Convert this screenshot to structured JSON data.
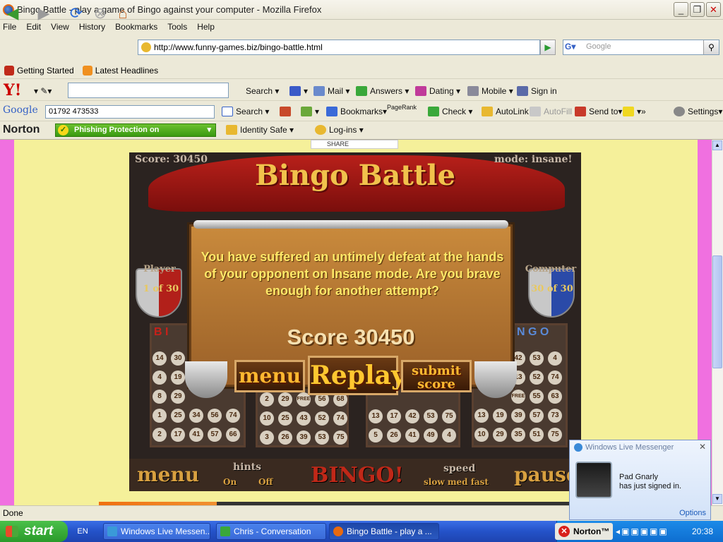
{
  "window": {
    "title": "Bingo Battle - play a game of Bingo against your computer - Mozilla Firefox",
    "minimize": "_",
    "maximize": "❐",
    "close": "✕"
  },
  "menu": [
    "File",
    "Edit",
    "View",
    "History",
    "Bookmarks",
    "Tools",
    "Help"
  ],
  "nav": {
    "url": "http://www.funny-games.biz/bingo-battle.html",
    "search_placeholder": "Google"
  },
  "bookmarks": [
    "Getting Started",
    "Latest Headlines"
  ],
  "yahoo": {
    "logo": "Y!",
    "search_label": "Search",
    "items": [
      "Mail",
      "Answers",
      "Dating",
      "Mobile",
      "Sign in"
    ]
  },
  "googlebar": {
    "logo": "Google",
    "query": "01792 473533",
    "items": [
      "Search",
      "Bookmarks",
      "PageRank",
      "Check",
      "AutoLink",
      "AutoFill",
      "Send to",
      "»",
      "Settings"
    ]
  },
  "norton": {
    "logo": "Norton",
    "phishing": "Phishing Protection on",
    "identity": "Identity Safe",
    "logins": "Log-ins"
  },
  "share": "SHARE",
  "game": {
    "title": "Bingo Battle",
    "score_tl": "Score: 30450",
    "mode": "mode: insane!",
    "player_label": "Player",
    "player_count": "1 of 30",
    "computer_label": "Computer",
    "computer_count": "30 of 30",
    "message": "You have suffered an untimely defeat at the hands of your opponent on Insane mode. Are you brave enough for another attempt?",
    "score_line": "Score 30450",
    "btn_menu": "menu",
    "btn_replay": "Replay",
    "btn_submit": "submit score",
    "bottom": {
      "menu": "menu",
      "hints": "hints",
      "hints_on": "On",
      "hints_off": "Off",
      "bingo": "BINGO!",
      "speed": "speed",
      "speed_opts": "slow med fast",
      "pause": "pause"
    },
    "card_left_header": "B I",
    "card_right_header": "N G O",
    "card1": [
      [
        "14",
        "30"
      ],
      [
        "4",
        "19"
      ],
      [
        "8",
        "29"
      ],
      [
        "1",
        "25",
        "34",
        "56",
        "74"
      ],
      [
        "2",
        "17",
        "41",
        "57",
        "66"
      ]
    ],
    "card2": [
      [
        "2",
        "29",
        "FREE",
        "56",
        "68"
      ],
      [
        "10",
        "25",
        "43",
        "52",
        "74"
      ],
      [
        "3",
        "26",
        "39",
        "53",
        "75"
      ]
    ],
    "card3": [
      [
        "13",
        "17",
        "42",
        "53",
        "75"
      ],
      [
        "5",
        "26",
        "41",
        "49",
        "4"
      ]
    ],
    "card4": [
      [
        "42",
        "53",
        "4"
      ],
      [
        "13",
        "52",
        "74"
      ],
      [
        "FREE",
        "55",
        "63"
      ],
      [
        "13",
        "19",
        "39",
        "57",
        "73"
      ],
      [
        "10",
        "29",
        "35",
        "51",
        "75"
      ]
    ]
  },
  "status": "Done",
  "messenger": {
    "title": "Windows Live Messenger",
    "user": "Pad Gnarly",
    "action": "has just signed in.",
    "options": "Options"
  },
  "taskbar": {
    "start": "start",
    "lang": "EN",
    "tasks": [
      "Windows Live Messen...",
      "Chris - Conversation",
      "Bingo Battle - play a ..."
    ],
    "norton": "Norton™",
    "clock": "20:38"
  }
}
